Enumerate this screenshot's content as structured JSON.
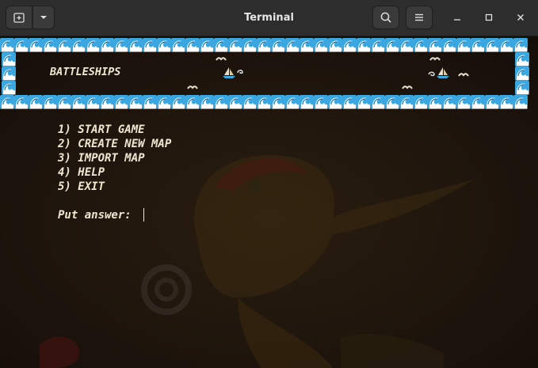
{
  "window": {
    "title": "Terminal"
  },
  "terminal": {
    "banner_title": "BATTLESHIPS",
    "menu": [
      {
        "text": "1) START GAME"
      },
      {
        "text": "2) CREATE NEW MAP"
      },
      {
        "text": "3) IMPORT MAP"
      },
      {
        "text": "4) HELP"
      },
      {
        "text": "5) EXIT"
      }
    ],
    "prompt": "Put answer:",
    "input_value": ""
  },
  "icons": {
    "border": "water-wave-emoji",
    "boat": "sailboat-emoji",
    "seagull": "seagull-glyph",
    "splash": "splash-glyph"
  },
  "colors": {
    "titlebar": "#2d2d2d",
    "terminal_bg": "#1d150e",
    "text": "#efe6d2",
    "wave_blue": "#3aa7e0"
  }
}
